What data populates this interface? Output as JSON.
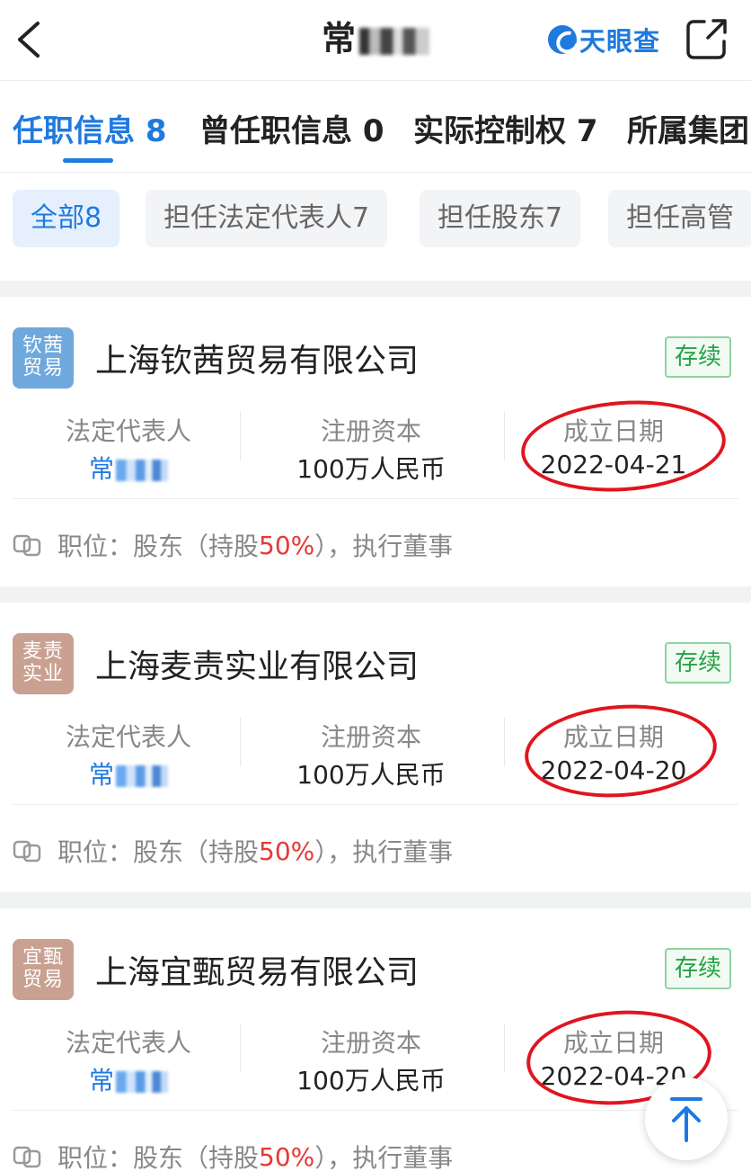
{
  "header": {
    "title": "常",
    "brand": "天眼查"
  },
  "tabs": [
    {
      "label": "任职信息 8",
      "active": true
    },
    {
      "label": "曾任职信息 0",
      "active": false
    },
    {
      "label": "实际控制权 7",
      "active": false
    },
    {
      "label": "所属集团",
      "active": false
    }
  ],
  "filters": [
    {
      "label": "全部8",
      "active": true
    },
    {
      "label": "担任法定代表人7",
      "active": false
    },
    {
      "label": "担任股东7",
      "active": false
    },
    {
      "label": "担任高管",
      "active": false
    }
  ],
  "labels": {
    "legal_rep": "法定代表人",
    "capital": "注册资本",
    "founded": "成立日期",
    "position_prefix": "职位：股东（持股",
    "position_suffix": "），执行董事"
  },
  "companies": [
    {
      "logo_text": "钦茜贸易",
      "logo_color": "#6fa8dc",
      "name": "上海钦茜贸易有限公司",
      "status": "存续",
      "legal_rep": "常",
      "capital": "100万人民币",
      "founded": "2022-04-21",
      "share": "50%"
    },
    {
      "logo_text": "麦责实业",
      "logo_color": "#c9a191",
      "name": "上海麦责实业有限公司",
      "status": "存续",
      "legal_rep": "常",
      "capital": "100万人民币",
      "founded": "2022-04-20",
      "share": "50%"
    },
    {
      "logo_text": "宜甄贸易",
      "logo_color": "#c9a191",
      "name": "上海宜甄贸易有限公司",
      "status": "存续",
      "legal_rep": "常",
      "capital": "100万人民币",
      "founded": "2022-04-20",
      "share": "50%"
    }
  ],
  "colors": {
    "accent": "#1f7ae0",
    "status_green": "#25a244",
    "share_red": "#e53935",
    "annotation_red": "#e0151f"
  }
}
